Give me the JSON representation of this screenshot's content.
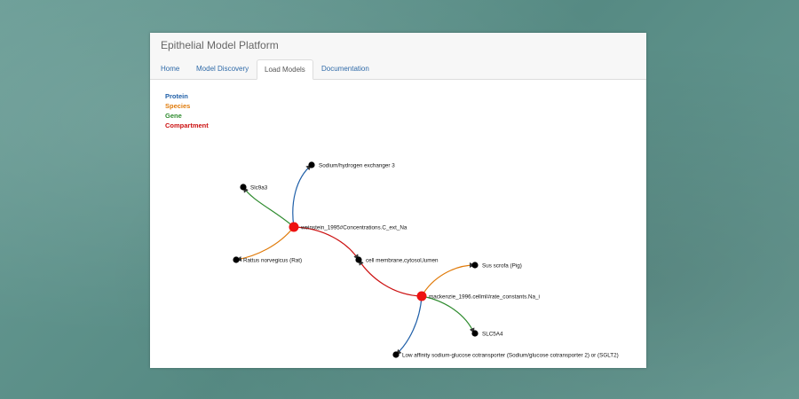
{
  "app": {
    "title": "Epithelial Model Platform"
  },
  "tabs": [
    {
      "label": "Home",
      "active": false
    },
    {
      "label": "Model Discovery",
      "active": false
    },
    {
      "label": "Load Models",
      "active": true
    },
    {
      "label": "Documentation",
      "active": false
    }
  ],
  "legend": [
    {
      "label": "Protein",
      "color": "#1f5fa8"
    },
    {
      "label": "Species",
      "color": "#e07b0b"
    },
    {
      "label": "Gene",
      "color": "#2e8b2e"
    },
    {
      "label": "Compartment",
      "color": "#cc1111"
    }
  ],
  "graph": {
    "nodes": [
      {
        "id": "n1",
        "label": "weinstein_1995#Concentrations.C_ext_Na",
        "kind": "hub"
      },
      {
        "id": "n2",
        "label": "Sodium/hydrogen exchanger 3",
        "kind": "leaf"
      },
      {
        "id": "n3",
        "label": "Slc9a3",
        "kind": "leaf"
      },
      {
        "id": "n4",
        "label": "Rattus norvegicus (Rat)",
        "kind": "leaf"
      },
      {
        "id": "n5",
        "label": "cell membrane,cytosol,lumen",
        "kind": "leaf"
      },
      {
        "id": "n6",
        "label": "mackenzie_1996.cellml#rate_constants.Na_i",
        "kind": "hub"
      },
      {
        "id": "n7",
        "label": "Sus scrofa (Pig)",
        "kind": "leaf"
      },
      {
        "id": "n8",
        "label": "SLC5A4",
        "kind": "leaf"
      },
      {
        "id": "n9",
        "label": "Low affinity sodium-glucose cotransporter (Sodium/glucose cotransporter 2) or (SGLT2)",
        "kind": "leaf"
      }
    ],
    "links": [
      {
        "source": "n1",
        "target": "n2",
        "type": "Protein"
      },
      {
        "source": "n1",
        "target": "n3",
        "type": "Gene"
      },
      {
        "source": "n1",
        "target": "n4",
        "type": "Species"
      },
      {
        "source": "n1",
        "target": "n5",
        "type": "Compartment"
      },
      {
        "source": "n6",
        "target": "n5",
        "type": "Compartment"
      },
      {
        "source": "n6",
        "target": "n7",
        "type": "Species"
      },
      {
        "source": "n6",
        "target": "n8",
        "type": "Gene"
      },
      {
        "source": "n6",
        "target": "n9",
        "type": "Protein"
      }
    ]
  }
}
